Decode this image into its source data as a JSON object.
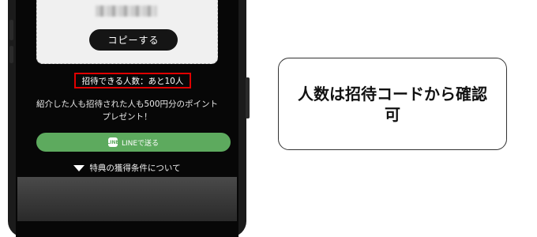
{
  "screen": {
    "copy_button_label": "コピーする",
    "invite_count_text": "招待できる人数：あと10人",
    "description_line1": "紹介した人も招待された人も500円分のポイント",
    "description_line2": "プレゼント！",
    "line_icon_text": "LINE",
    "line_button_label": "LINEで送る",
    "conditions_link_text": "特典の獲得条件について"
  },
  "callout": {
    "text": "人数は招待コードから確認可"
  },
  "colors": {
    "highlight_border": "#e00000",
    "line_green": "#5daa5e"
  }
}
